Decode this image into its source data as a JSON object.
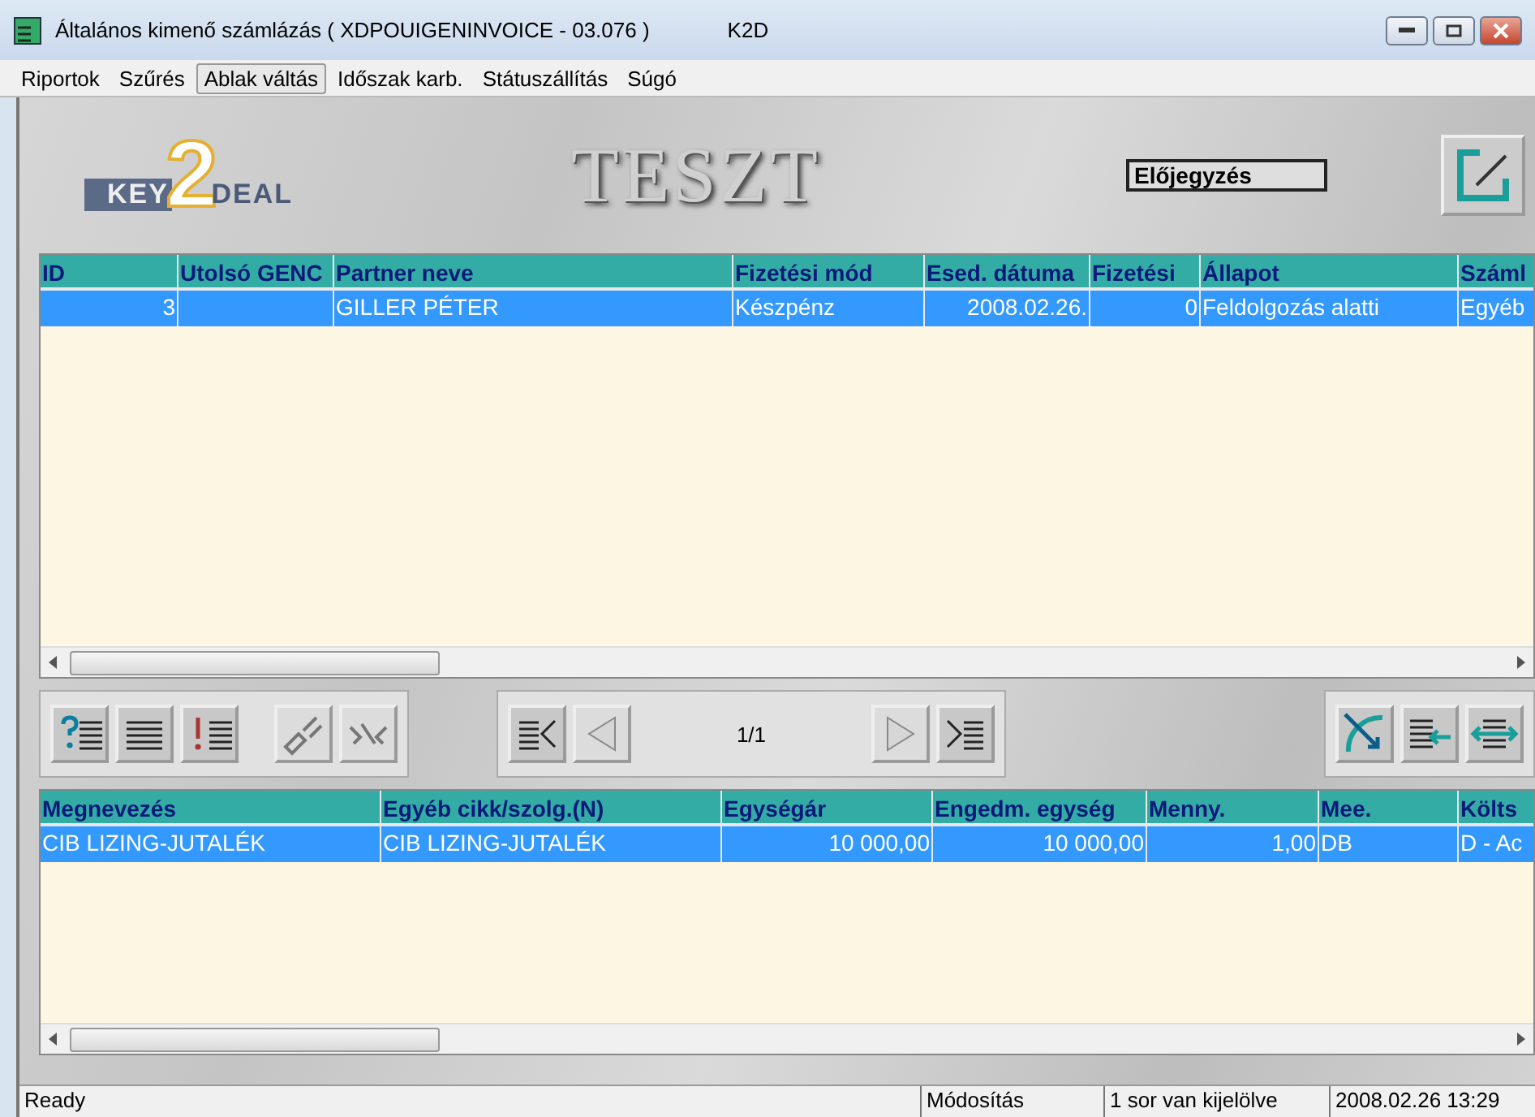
{
  "window": {
    "title": "Általános kimenő számlázás ( XDPOUIGENINVOICE - 03.076 )",
    "app": "K2D"
  },
  "menu": [
    {
      "label": "Riportok",
      "selected": false
    },
    {
      "label": "Szűrés",
      "selected": false
    },
    {
      "label": "Ablak váltás",
      "selected": true
    },
    {
      "label": "Időszak karb.",
      "selected": false
    },
    {
      "label": "Státuszállítás",
      "selected": false
    },
    {
      "label": "Súgó",
      "selected": false
    }
  ],
  "header": {
    "logo_left": "KEY",
    "logo_digit": "2",
    "logo_right": "DEAL",
    "banner": "TESZT",
    "status_field": "Előjegyzés"
  },
  "invoices": {
    "columns": [
      {
        "label": "ID",
        "kind": "number"
      },
      {
        "label": "Utolsó GENC",
        "kind": "text"
      },
      {
        "label": "Partner neve",
        "kind": "text"
      },
      {
        "label": "Fizetési mód",
        "kind": "text"
      },
      {
        "label": "Esed. dátuma",
        "kind": "number"
      },
      {
        "label": "Fizetési ",
        "kind": "number"
      },
      {
        "label": "Állapot",
        "kind": "text"
      },
      {
        "label": "Száml",
        "kind": "text"
      }
    ],
    "rows": [
      {
        "selected": true,
        "cells": [
          "3",
          null,
          "GILLER PÉTER",
          "Készpénz",
          "2008.02.26.",
          "0",
          "Feldolgozás alatti",
          "Egyéb"
        ]
      }
    ]
  },
  "pager": {
    "position": "1/1"
  },
  "items": {
    "columns": [
      {
        "label": "Megnevezés",
        "kind": "text"
      },
      {
        "label": "Egyéb cikk/szolg.(N)",
        "kind": "text"
      },
      {
        "label": "Egységár",
        "kind": "number"
      },
      {
        "label": "Engedm. egység",
        "kind": "number"
      },
      {
        "label": "Menny.",
        "kind": "number"
      },
      {
        "label": "Mee.",
        "kind": "text"
      },
      {
        "label": "Költs",
        "kind": "text"
      }
    ],
    "rows": [
      {
        "selected": true,
        "cells": [
          "CIB LIZING-JUTALÉK",
          "CIB LIZING-JUTALÉK",
          "10 000,00",
          "10 000,00",
          "1,00",
          "DB",
          "D - Ac"
        ]
      }
    ]
  },
  "status_bar": [
    "Ready",
    "Módosítás",
    "1 sor van kijelölve",
    "2008.02.26 13:29"
  ]
}
